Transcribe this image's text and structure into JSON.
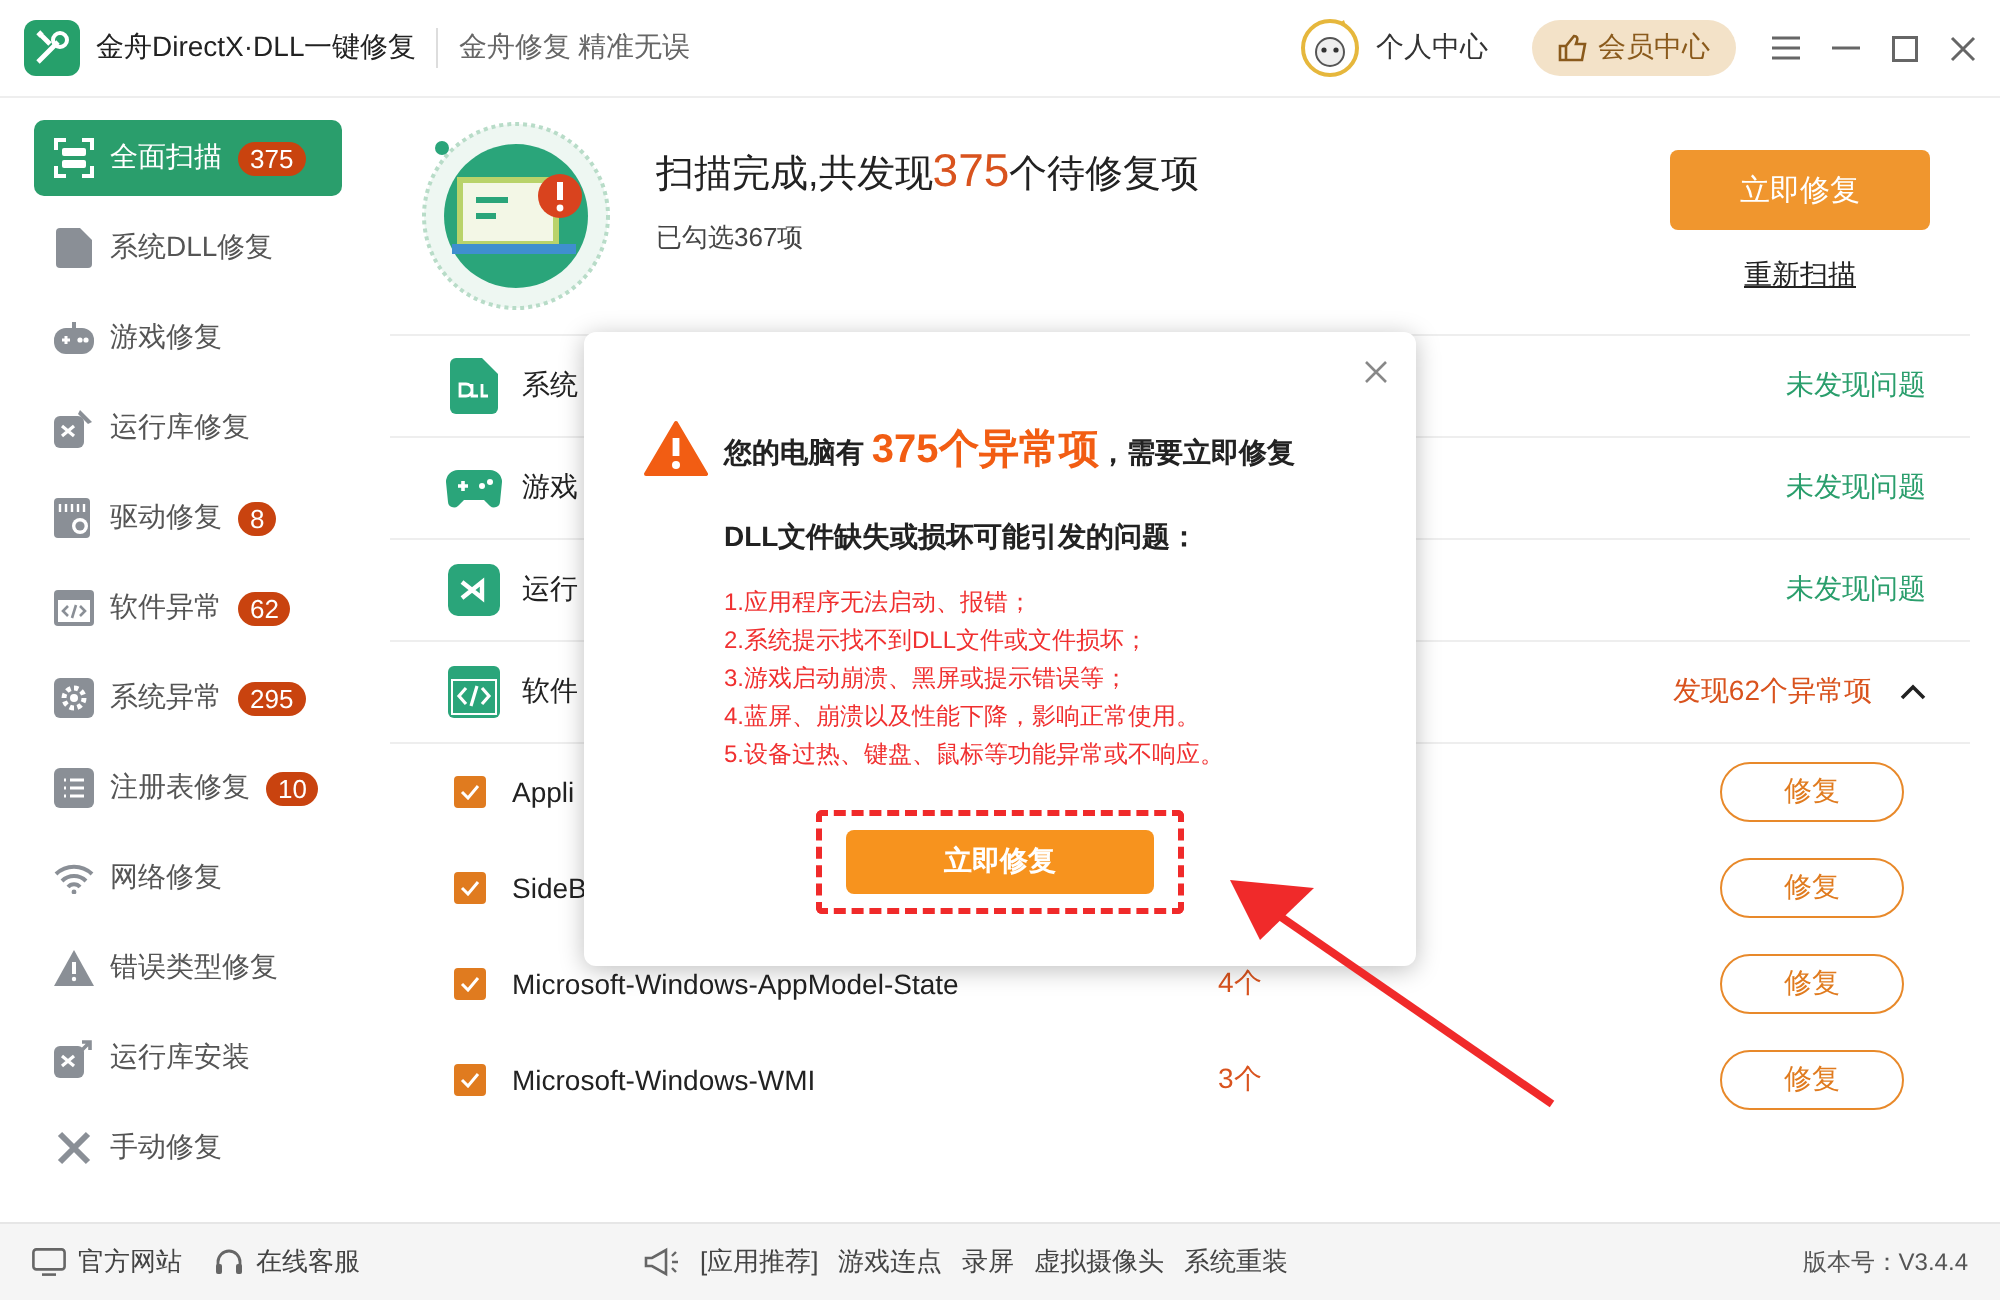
{
  "app": {
    "title": "金舟DirectX·DLL一键修复",
    "slogan": "金舟修复 精准无误",
    "user": "个人中心",
    "vip": "会员中心"
  },
  "sidebar": {
    "items": [
      {
        "label": "全面扫描",
        "badge": "375",
        "selected": true
      },
      {
        "label": "系统DLL修复",
        "selected": false
      },
      {
        "label": "游戏修复",
        "selected": false
      },
      {
        "label": "运行库修复",
        "selected": false
      },
      {
        "label": "驱动修复",
        "badge": "8",
        "selected": false
      },
      {
        "label": "软件异常",
        "badge": "62",
        "selected": false
      },
      {
        "label": "系统异常",
        "badge": "295",
        "selected": false
      },
      {
        "label": "注册表修复",
        "badge": "10",
        "selected": false
      },
      {
        "label": "网络修复",
        "selected": false
      },
      {
        "label": "错误类型修复",
        "selected": false
      },
      {
        "label": "运行库安装",
        "selected": false
      },
      {
        "label": "手动修复",
        "selected": false
      }
    ]
  },
  "summary": {
    "title_before": "扫描完成,共发现",
    "count": "375",
    "title_after": "个待修复项",
    "checked": "已勾选367项",
    "fix_button": "立即修复",
    "rescan": "重新扫描"
  },
  "categories": [
    {
      "name": "系统",
      "status": "未发现问题",
      "kind": "ok"
    },
    {
      "name": "游戏",
      "status": "未发现问题",
      "kind": "ok"
    },
    {
      "name": "运行",
      "status": "未发现问题",
      "kind": "ok"
    },
    {
      "name": "软件",
      "status": "发现62个异常项",
      "kind": "issues",
      "expanded": true
    }
  ],
  "items": [
    {
      "checked": true,
      "name": "Appli",
      "button": "修复"
    },
    {
      "checked": true,
      "name": "SideB",
      "button": "修复"
    },
    {
      "checked": true,
      "name": "Microsoft-Windows-AppModel-State",
      "count": "4个",
      "button": "修复"
    },
    {
      "checked": true,
      "name": "Microsoft-Windows-WMI",
      "count": "3个",
      "button": "修复"
    }
  ],
  "modal": {
    "heading_before": "您的电脑有",
    "heading_count": "375个异常项",
    "heading_after": "，需要立即修复",
    "subtitle": "DLL文件缺失或损坏可能引发的问题：",
    "problems": [
      "1.应用程序无法启动、报错；",
      "2.系统提示找不到DLL文件或文件损坏；",
      "3.游戏启动崩溃、黑屏或提示错误等；",
      "4.蓝屏、崩溃以及性能下降，影响正常使用。",
      "5.设备过热、键盘、鼠标等功能异常或不响应。"
    ],
    "button": "立即修复"
  },
  "footer": {
    "links": [
      "官方网站",
      "在线客服"
    ],
    "recommend_label": "[应用推荐]",
    "recommend": [
      "游戏连点",
      "录屏",
      "虚拟摄像头",
      "系统重装"
    ],
    "version": "版本号：V3.4.4"
  }
}
